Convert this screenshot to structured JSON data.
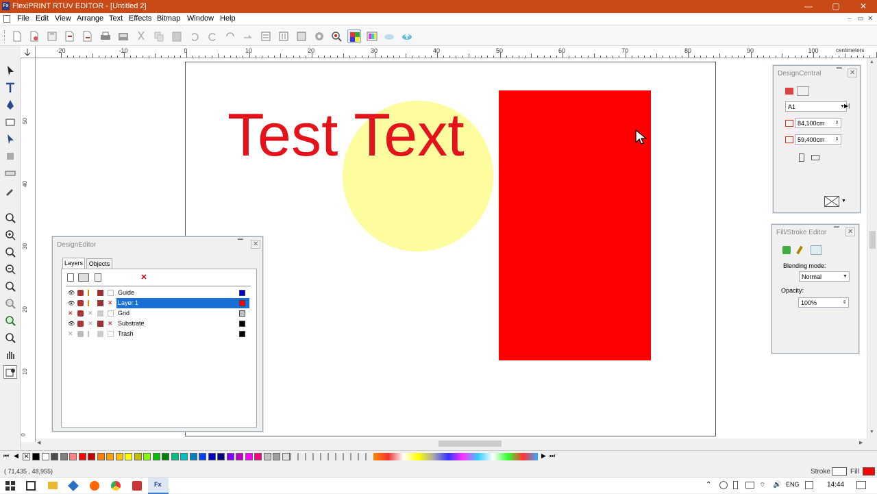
{
  "window": {
    "title": "FlexiPRINT RTUV EDITOR - [Untitled 2]",
    "app_icon_text": "Fx",
    "minimize": "—",
    "maximize": "▢",
    "close": "✕",
    "bar_color": "#c94a16"
  },
  "menu": {
    "items": [
      "File",
      "Edit",
      "View",
      "Arrange",
      "Text",
      "Effects",
      "Bitmap",
      "Window",
      "Help"
    ]
  },
  "ruler": {
    "unit": "centimeters",
    "h_labels": [
      "-20",
      "-10",
      "0",
      "10",
      "20",
      "30",
      "40",
      "50",
      "60",
      "70",
      "80",
      "90",
      "100"
    ],
    "v_labels": [
      "50",
      "40",
      "30",
      "20",
      "10",
      "0"
    ]
  },
  "canvas": {
    "text_object": "Test Text",
    "text_color": "#e4131b",
    "circle_color": "#fdfda0",
    "rect_color": "#ff0000"
  },
  "design_editor": {
    "title": "DesignEditor",
    "tabs": [
      "Layers",
      "Objects"
    ],
    "layers": [
      {
        "name": "Guide",
        "color": "#0000cc"
      },
      {
        "name": "Layer 1",
        "color": "#ff0000",
        "selected": true
      },
      {
        "name": "Grid",
        "color": "#c0c0c0"
      },
      {
        "name": "Substrate",
        "color": "#000000"
      },
      {
        "name": "Trash",
        "color": "#000000"
      }
    ]
  },
  "design_central": {
    "title": "DesignCentral",
    "size_select": "A1",
    "width": "84,100cm",
    "height": "59,400cm"
  },
  "fill_stroke": {
    "title": "Fill/Stroke Editor",
    "blending_label": "Blending mode:",
    "blending_value": "Normal",
    "opacity_label": "Opacity:",
    "opacity_value": "100%"
  },
  "status": {
    "coords": "( 71,435 ,   48,955)",
    "stroke_label": "Stroke",
    "fill_label": "Fill",
    "fill_color": "#ff0000"
  },
  "taskbar": {
    "lang": "ENG",
    "time": "14:44",
    "active_app": "Fx"
  },
  "palette_colors": [
    "#000000",
    "#ffffff",
    "#4d4d4d",
    "#808080",
    "#ff8080",
    "#ff0000",
    "#c00000",
    "#ff8000",
    "#ffa000",
    "#ffc000",
    "#ffff00",
    "#c0c000",
    "#80ff00",
    "#00c000",
    "#008000",
    "#00c080",
    "#00c0c0",
    "#0080c0",
    "#0040ff",
    "#0000c0",
    "#000080",
    "#8000ff",
    "#c000c0",
    "#ff00ff",
    "#ff0080",
    "#c0c0c0",
    "#a0a0a0",
    "#e0e0e0"
  ]
}
